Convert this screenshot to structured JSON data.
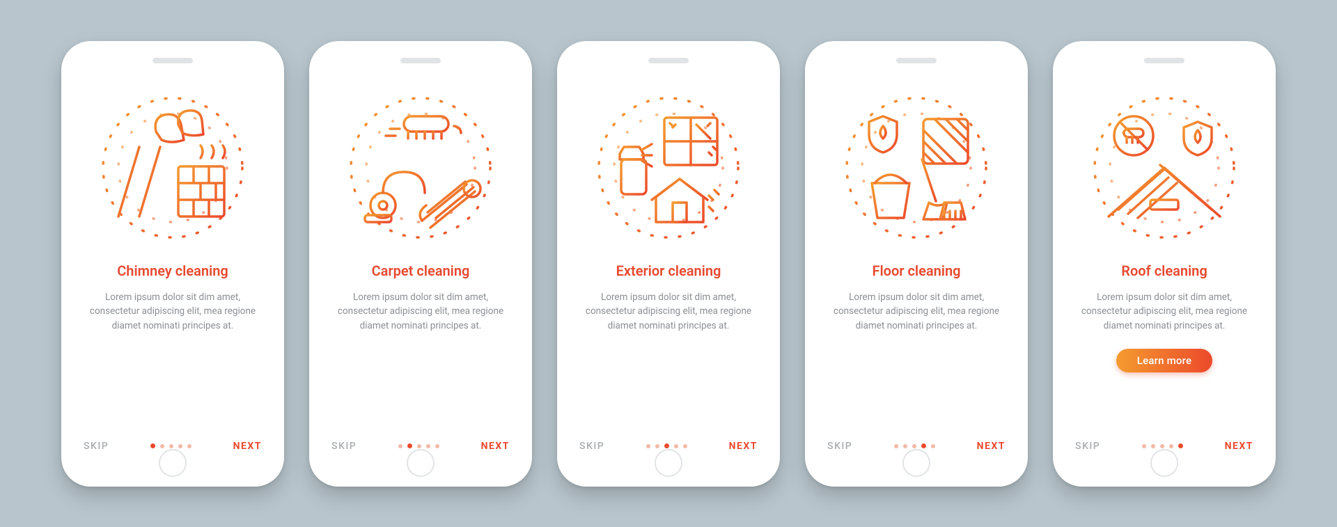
{
  "common": {
    "skip_label": "SKIP",
    "next_label": "NEXT",
    "body_text": "Lorem ipsum dolor sit dim amet, consectetur adipiscing elit, mea regione diamet nominati principes at.",
    "cta_label": "Learn more",
    "page_count": 5
  },
  "colors": {
    "gradient_start": "#f49b2f",
    "gradient_end": "#ec4a2b",
    "background": "#b8c5cc",
    "muted_text": "#8b8f92"
  },
  "screens": [
    {
      "title": "Chimney cleaning",
      "icon_name": "chimney-cleaning-icon",
      "active_index": 0,
      "has_cta": false
    },
    {
      "title": "Carpet cleaning",
      "icon_name": "carpet-cleaning-icon",
      "active_index": 1,
      "has_cta": false
    },
    {
      "title": "Exterior cleaning",
      "icon_name": "exterior-cleaning-icon",
      "active_index": 2,
      "has_cta": false
    },
    {
      "title": "Floor cleaning",
      "icon_name": "floor-cleaning-icon",
      "active_index": 3,
      "has_cta": false
    },
    {
      "title": "Roof cleaning",
      "icon_name": "roof-cleaning-icon",
      "active_index": 4,
      "has_cta": true
    }
  ]
}
